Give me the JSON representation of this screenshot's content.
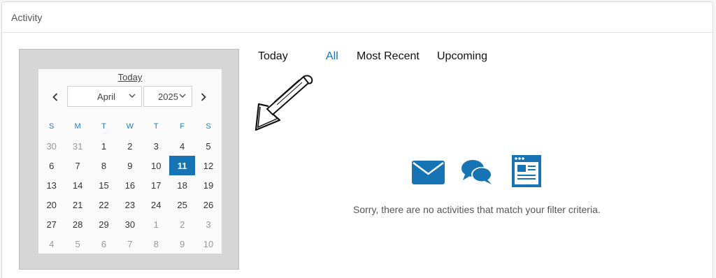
{
  "panel": {
    "title": "Activity"
  },
  "calendar": {
    "today_label": "Today",
    "month": "April",
    "year": "2025",
    "weekdays": [
      "S",
      "M",
      "T",
      "W",
      "T",
      "F",
      "S"
    ],
    "weeks": [
      [
        "30",
        "31",
        "1",
        "2",
        "3",
        "4",
        "5"
      ],
      [
        "6",
        "7",
        "8",
        "9",
        "10",
        "11",
        "12"
      ],
      [
        "13",
        "14",
        "15",
        "16",
        "17",
        "18",
        "19"
      ],
      [
        "20",
        "21",
        "22",
        "23",
        "24",
        "25",
        "26"
      ],
      [
        "27",
        "28",
        "29",
        "30",
        "1",
        "2",
        "3"
      ],
      [
        "4",
        "5",
        "6",
        "7",
        "8",
        "9",
        "10"
      ]
    ],
    "selected_day": "11",
    "accent_color": "#1674b5"
  },
  "tabs": [
    {
      "label": "Today",
      "active": false
    },
    {
      "label": "All",
      "active": true
    },
    {
      "label": "Most Recent",
      "active": false
    },
    {
      "label": "Upcoming",
      "active": false
    }
  ],
  "empty_state": {
    "icons": [
      "envelope-icon",
      "chat-bubbles-icon",
      "browser-window-icon"
    ],
    "message": "Sorry, there are no activities that match your filter criteria."
  }
}
